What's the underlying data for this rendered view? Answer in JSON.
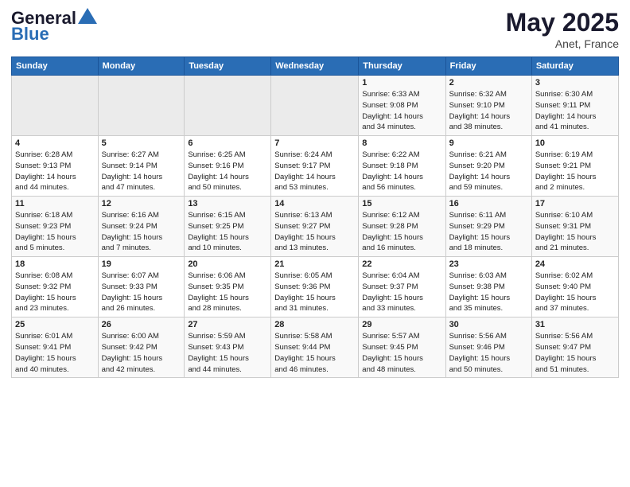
{
  "header": {
    "logo_line1": "General",
    "logo_line2": "Blue",
    "month": "May 2025",
    "location": "Anet, France"
  },
  "days_of_week": [
    "Sunday",
    "Monday",
    "Tuesday",
    "Wednesday",
    "Thursday",
    "Friday",
    "Saturday"
  ],
  "weeks": [
    [
      {
        "day": "",
        "info": ""
      },
      {
        "day": "",
        "info": ""
      },
      {
        "day": "",
        "info": ""
      },
      {
        "day": "",
        "info": ""
      },
      {
        "day": "1",
        "info": "Sunrise: 6:33 AM\nSunset: 9:08 PM\nDaylight: 14 hours\nand 34 minutes."
      },
      {
        "day": "2",
        "info": "Sunrise: 6:32 AM\nSunset: 9:10 PM\nDaylight: 14 hours\nand 38 minutes."
      },
      {
        "day": "3",
        "info": "Sunrise: 6:30 AM\nSunset: 9:11 PM\nDaylight: 14 hours\nand 41 minutes."
      }
    ],
    [
      {
        "day": "4",
        "info": "Sunrise: 6:28 AM\nSunset: 9:13 PM\nDaylight: 14 hours\nand 44 minutes."
      },
      {
        "day": "5",
        "info": "Sunrise: 6:27 AM\nSunset: 9:14 PM\nDaylight: 14 hours\nand 47 minutes."
      },
      {
        "day": "6",
        "info": "Sunrise: 6:25 AM\nSunset: 9:16 PM\nDaylight: 14 hours\nand 50 minutes."
      },
      {
        "day": "7",
        "info": "Sunrise: 6:24 AM\nSunset: 9:17 PM\nDaylight: 14 hours\nand 53 minutes."
      },
      {
        "day": "8",
        "info": "Sunrise: 6:22 AM\nSunset: 9:18 PM\nDaylight: 14 hours\nand 56 minutes."
      },
      {
        "day": "9",
        "info": "Sunrise: 6:21 AM\nSunset: 9:20 PM\nDaylight: 14 hours\nand 59 minutes."
      },
      {
        "day": "10",
        "info": "Sunrise: 6:19 AM\nSunset: 9:21 PM\nDaylight: 15 hours\nand 2 minutes."
      }
    ],
    [
      {
        "day": "11",
        "info": "Sunrise: 6:18 AM\nSunset: 9:23 PM\nDaylight: 15 hours\nand 5 minutes."
      },
      {
        "day": "12",
        "info": "Sunrise: 6:16 AM\nSunset: 9:24 PM\nDaylight: 15 hours\nand 7 minutes."
      },
      {
        "day": "13",
        "info": "Sunrise: 6:15 AM\nSunset: 9:25 PM\nDaylight: 15 hours\nand 10 minutes."
      },
      {
        "day": "14",
        "info": "Sunrise: 6:13 AM\nSunset: 9:27 PM\nDaylight: 15 hours\nand 13 minutes."
      },
      {
        "day": "15",
        "info": "Sunrise: 6:12 AM\nSunset: 9:28 PM\nDaylight: 15 hours\nand 16 minutes."
      },
      {
        "day": "16",
        "info": "Sunrise: 6:11 AM\nSunset: 9:29 PM\nDaylight: 15 hours\nand 18 minutes."
      },
      {
        "day": "17",
        "info": "Sunrise: 6:10 AM\nSunset: 9:31 PM\nDaylight: 15 hours\nand 21 minutes."
      }
    ],
    [
      {
        "day": "18",
        "info": "Sunrise: 6:08 AM\nSunset: 9:32 PM\nDaylight: 15 hours\nand 23 minutes."
      },
      {
        "day": "19",
        "info": "Sunrise: 6:07 AM\nSunset: 9:33 PM\nDaylight: 15 hours\nand 26 minutes."
      },
      {
        "day": "20",
        "info": "Sunrise: 6:06 AM\nSunset: 9:35 PM\nDaylight: 15 hours\nand 28 minutes."
      },
      {
        "day": "21",
        "info": "Sunrise: 6:05 AM\nSunset: 9:36 PM\nDaylight: 15 hours\nand 31 minutes."
      },
      {
        "day": "22",
        "info": "Sunrise: 6:04 AM\nSunset: 9:37 PM\nDaylight: 15 hours\nand 33 minutes."
      },
      {
        "day": "23",
        "info": "Sunrise: 6:03 AM\nSunset: 9:38 PM\nDaylight: 15 hours\nand 35 minutes."
      },
      {
        "day": "24",
        "info": "Sunrise: 6:02 AM\nSunset: 9:40 PM\nDaylight: 15 hours\nand 37 minutes."
      }
    ],
    [
      {
        "day": "25",
        "info": "Sunrise: 6:01 AM\nSunset: 9:41 PM\nDaylight: 15 hours\nand 40 minutes."
      },
      {
        "day": "26",
        "info": "Sunrise: 6:00 AM\nSunset: 9:42 PM\nDaylight: 15 hours\nand 42 minutes."
      },
      {
        "day": "27",
        "info": "Sunrise: 5:59 AM\nSunset: 9:43 PM\nDaylight: 15 hours\nand 44 minutes."
      },
      {
        "day": "28",
        "info": "Sunrise: 5:58 AM\nSunset: 9:44 PM\nDaylight: 15 hours\nand 46 minutes."
      },
      {
        "day": "29",
        "info": "Sunrise: 5:57 AM\nSunset: 9:45 PM\nDaylight: 15 hours\nand 48 minutes."
      },
      {
        "day": "30",
        "info": "Sunrise: 5:56 AM\nSunset: 9:46 PM\nDaylight: 15 hours\nand 50 minutes."
      },
      {
        "day": "31",
        "info": "Sunrise: 5:56 AM\nSunset: 9:47 PM\nDaylight: 15 hours\nand 51 minutes."
      }
    ]
  ]
}
